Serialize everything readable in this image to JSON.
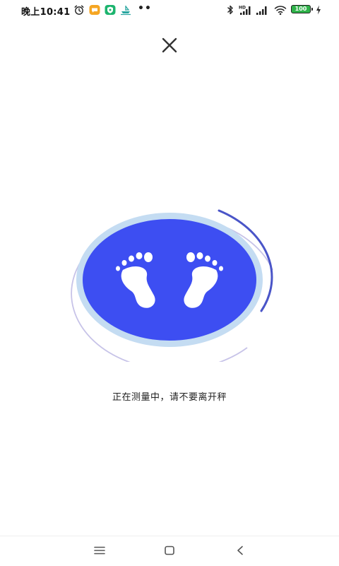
{
  "status_bar": {
    "time": "晚上10:41",
    "dots": "••",
    "battery_level": "100",
    "hd_label": "HD",
    "icons": [
      "alarm-icon",
      "chat-app-icon",
      "security-app-icon",
      "boat-app-icon",
      "bluetooth-icon",
      "signal-hd-icon",
      "signal-icon",
      "wifi-icon",
      "battery-icon",
      "charging-icon"
    ],
    "colors": {
      "chat_app": "#f5a623",
      "security_app": "#1cb46e",
      "boat_app": "#2aa6a0",
      "battery": "#2fb34a"
    }
  },
  "header": {
    "close_icon": "close-icon"
  },
  "scale": {
    "icon": "footprints-icon",
    "colors": {
      "platform": "#3d4ef2",
      "inner_ring": "#c4dcf2",
      "progress_arc": "#4a55c8",
      "outer_ring": "#c7c3e8"
    }
  },
  "message": {
    "text": "正在测量中，请不要离开秤"
  },
  "nav_bar": {
    "items": [
      "menu-icon",
      "home-icon",
      "back-icon"
    ]
  }
}
